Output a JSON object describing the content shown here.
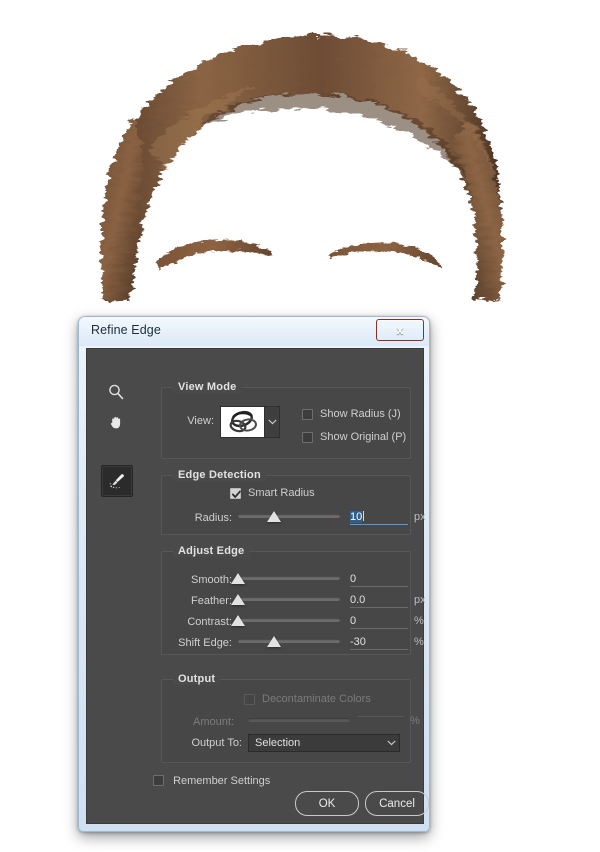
{
  "canvas": {
    "subject": "extracted-hair-and-eyebrows",
    "background_color": "#ffffff"
  },
  "dialog": {
    "title": "Refine Edge",
    "close_label": "x",
    "tools": [
      {
        "name": "zoom-tool",
        "label": "Zoom Tool",
        "selected": false
      },
      {
        "name": "hand-tool",
        "label": "Hand Tool",
        "selected": false
      },
      {
        "name": "refine-radius-tool",
        "label": "Refine Radius Tool",
        "selected": true
      }
    ],
    "view_mode": {
      "title": "View Mode",
      "view_label": "View:",
      "view_value": "Onion Skin",
      "show_radius": {
        "label": "Show Radius (J)",
        "checked": false
      },
      "show_original": {
        "label": "Show Original (P)",
        "checked": false
      }
    },
    "edge_detection": {
      "title": "Edge Detection",
      "smart_radius": {
        "label": "Smart Radius",
        "checked": true
      },
      "radius": {
        "label": "Radius:",
        "value": "10",
        "unit": "px",
        "slider_percent": 35,
        "editing": true
      }
    },
    "adjust_edge": {
      "title": "Adjust Edge",
      "rows": [
        {
          "label": "Smooth:",
          "value": "0",
          "unit": "",
          "slider_percent": 0
        },
        {
          "label": "Feather:",
          "value": "0.0",
          "unit": "px",
          "slider_percent": 0
        },
        {
          "label": "Contrast:",
          "value": "0",
          "unit": "%",
          "slider_percent": 0
        },
        {
          "label": "Shift Edge:",
          "value": "-30",
          "unit": "%",
          "slider_percent": 35
        }
      ]
    },
    "output": {
      "title": "Output",
      "decontaminate_colors": {
        "label": "Decontaminate Colors",
        "checked": false,
        "enabled": false
      },
      "amount": {
        "label": "Amount:",
        "value": "",
        "unit": "%",
        "slider_percent": 100,
        "enabled": false
      },
      "output_to": {
        "label": "Output To:",
        "value": "Selection"
      }
    },
    "remember_settings": {
      "label": "Remember Settings",
      "checked": false
    },
    "buttons": {
      "ok": "OK",
      "cancel": "Cancel"
    }
  },
  "colors": {
    "panel_background": "#4a4a4a",
    "group_background": "#474747",
    "title_bar": "#e6f0fa",
    "close_button": "#cc4a32",
    "active_field_underline": "#4e9bdd",
    "selection_highlight": "#2f5f8f"
  }
}
